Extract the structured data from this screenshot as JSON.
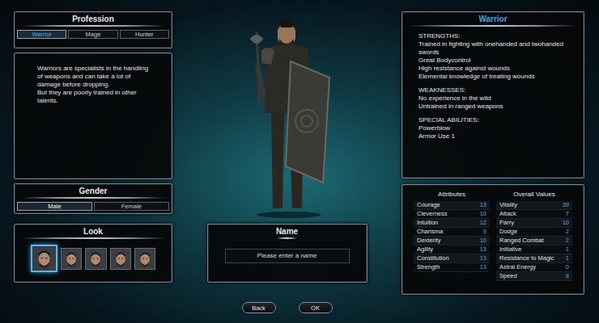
{
  "profession": {
    "title": "Profession",
    "tabs": [
      {
        "label": "Warrior",
        "selected": true
      },
      {
        "label": "Mage",
        "selected": false
      },
      {
        "label": "Hunter",
        "selected": false
      }
    ],
    "description": [
      "Warriors are specialists in the handling of weapons and can take a lot of damage before dropping.",
      "But they are poorly trained in other talents."
    ]
  },
  "gender": {
    "title": "Gender",
    "options": [
      {
        "label": "Male",
        "selected": true
      },
      {
        "label": "Female",
        "selected": false
      }
    ]
  },
  "look": {
    "title": "Look",
    "portraits": [
      {
        "selected": true
      },
      {
        "selected": false
      },
      {
        "selected": false
      },
      {
        "selected": false
      },
      {
        "selected": false
      }
    ]
  },
  "name": {
    "title": "Name",
    "placeholder": "Please enter a name"
  },
  "details": {
    "title": "Warrior",
    "sections": [
      {
        "heading": "STRENGTHS:",
        "items": [
          "Trained in fighting with onehanded and twohanded swords",
          "Great Bodycontrol",
          "High resistance against wounds",
          "Elemental knowledge of treating wounds"
        ]
      },
      {
        "heading": "WEAKNESSES:",
        "items": [
          "No experience in the wild",
          "Untrained in ranged weapons"
        ]
      },
      {
        "heading": "SPECIAL ABILITIES:",
        "items": [
          "Powerblow",
          "Armor Use 1"
        ]
      }
    ]
  },
  "stats": {
    "attributes_title": "Attributes",
    "overall_title": "Overall Values",
    "attributes": [
      {
        "label": "Courage",
        "value": "13"
      },
      {
        "label": "Cleverness",
        "value": "10"
      },
      {
        "label": "Intuition",
        "value": "12"
      },
      {
        "label": "Charisma",
        "value": "9"
      },
      {
        "label": "Dexterity",
        "value": "10"
      },
      {
        "label": "Agility",
        "value": "13"
      },
      {
        "label": "Constitution",
        "value": "13"
      },
      {
        "label": "Strength",
        "value": "13"
      }
    ],
    "overall": [
      {
        "label": "Vitality",
        "value": "39"
      },
      {
        "label": "Attack",
        "value": "7"
      },
      {
        "label": "Parry",
        "value": "10"
      },
      {
        "label": "Dodge",
        "value": "2"
      },
      {
        "label": "Ranged Combat",
        "value": "2"
      },
      {
        "label": "Initiative",
        "value": "1"
      },
      {
        "label": "Resistance to Magic",
        "value": "1"
      },
      {
        "label": "Astral Energy",
        "value": "0"
      },
      {
        "label": "Speed",
        "value": "8"
      }
    ]
  },
  "buttons": [
    "Back",
    "OK"
  ]
}
